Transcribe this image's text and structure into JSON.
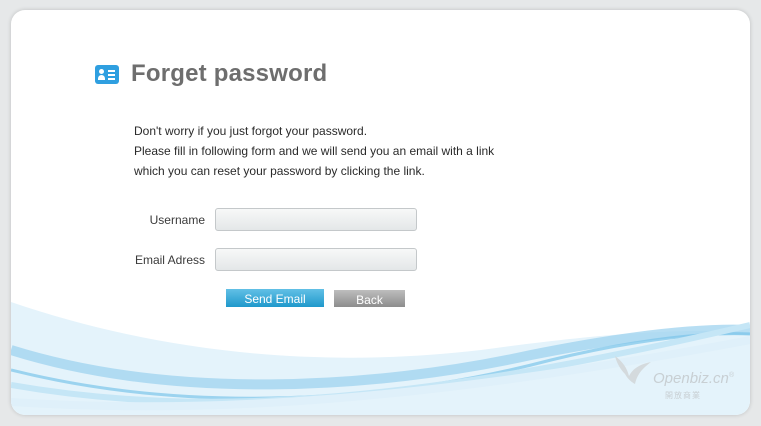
{
  "page": {
    "title": "Forget password",
    "intro_lines": [
      "Don't worry if you just forgot your password.",
      "Please fill in following form and we will send you an email with a link",
      "which you can reset your password by clicking the link."
    ]
  },
  "form": {
    "username_label": "Username",
    "username_value": "",
    "email_label": "Email Adress",
    "email_value": "",
    "send_label": "Send Email",
    "back_label": "Back"
  },
  "brand": {
    "name": "Openbiz.cn",
    "registered": "®",
    "chinese": "開放商業"
  },
  "colors": {
    "accent": "#2f9fe0",
    "send_button": "#1f98cb",
    "back_button": "#8d8d8d",
    "wave": "#bfe2f5"
  },
  "icons": {
    "title": "user-card-icon",
    "logo": "bird-logo-icon"
  }
}
